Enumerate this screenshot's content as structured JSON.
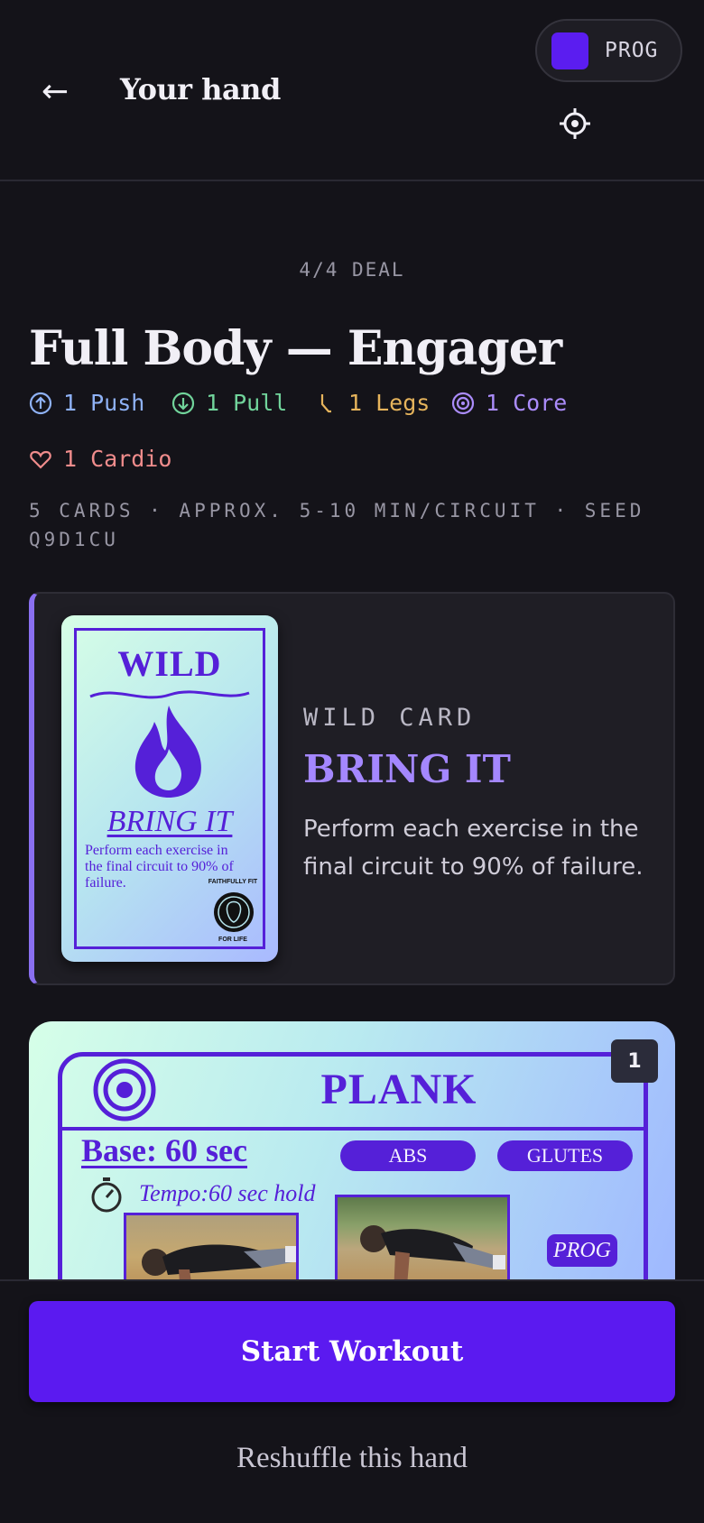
{
  "header": {
    "back_label": "←",
    "title": "Your hand",
    "prog_label": "PROG",
    "prog_swatch_color": "#5b1df0",
    "settings_icon": "gear-icon"
  },
  "deal": {
    "counter": "4/4 DEAL",
    "title": "Full Body — Engager",
    "meta": "5 CARDS · APPROX. 5-10 MIN/CIRCUIT · SEED Q9D1CU"
  },
  "tags": [
    {
      "label": "1 Push",
      "icon": "arrow-up-circle-icon",
      "color": "#8fb2f6"
    },
    {
      "label": "1 Pull",
      "icon": "arrow-down-circle-icon",
      "color": "#71d49b"
    },
    {
      "label": "1 Legs",
      "icon": "leg-icon",
      "color": "#e6b45c"
    },
    {
      "label": "1 Core",
      "icon": "target-icon",
      "color": "#ab8cfb"
    },
    {
      "label": "1 Cardio",
      "icon": "heart-icon",
      "color": "#f08c8c"
    }
  ],
  "wild_card": {
    "kicker": "WILD CARD",
    "name": "BRING IT",
    "description": "Perform each exercise in the final circuit to 90% of failure.",
    "accent_color": "#8a6ff0",
    "thumb": {
      "heading": "WILD",
      "subheading": "BRING IT",
      "text": "Perform each exercise in the final circuit to 90% of failure.",
      "logo_top": "FAITHFULLY FIT",
      "logo_bottom": "FOR LIFE"
    }
  },
  "exercise_card": {
    "number": "1",
    "name": "PLANK",
    "base": "Base: 60 sec",
    "muscles": [
      "ABS",
      "GLUTES"
    ],
    "tempo": "Tempo:60 sec hold",
    "prog_tag": "PROG"
  },
  "actions": {
    "start": "Start Workout",
    "reshuffle": "Reshuffle this hand"
  },
  "colors": {
    "background": "#141319",
    "primary": "#5b1af0",
    "card_ink": "#5520d8"
  }
}
